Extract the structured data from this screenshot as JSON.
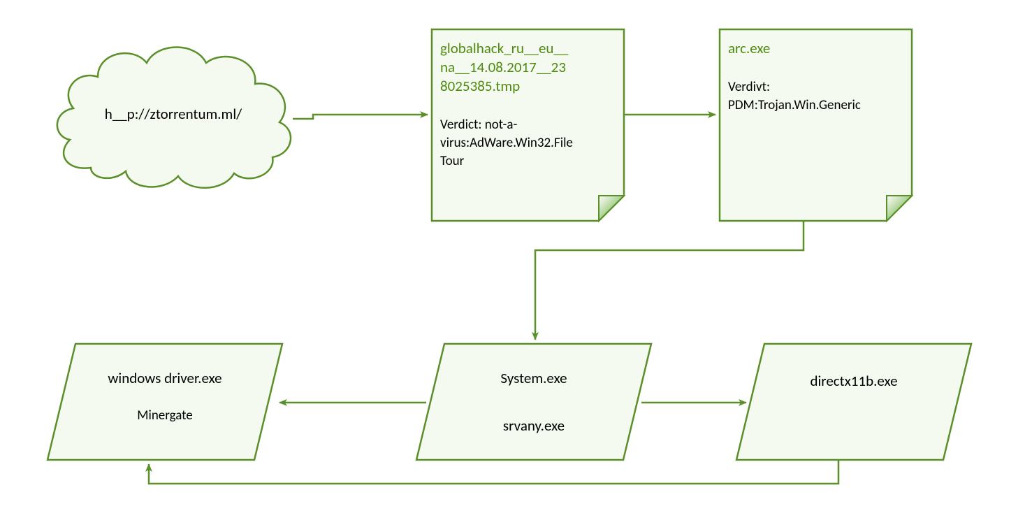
{
  "colors": {
    "stroke": "#5a8f29",
    "fill": "#f5faf0",
    "foldDark": "#3e6b1c",
    "foldLight": "#a9d18e",
    "text": "#000000",
    "greenText": "#5a8f29"
  },
  "cloud": {
    "label": "h__p://ztorrentum.ml/"
  },
  "note1": {
    "title1": "globalhack_ru__eu__",
    "title2": "na__14.08.2017__23",
    "title3": "8025385.tmp",
    "body1": "Verdict: not-a-",
    "body2": "virus:AdWare.Win32.File",
    "body3": "Tour"
  },
  "note2": {
    "title1": "arc.exe",
    "body1": "Verdivt:",
    "body2": "PDM:Trojan.Win.Generic"
  },
  "para1": {
    "line1": "windows driver.exe",
    "line2": "Minergate"
  },
  "para2": {
    "line1": "System.exe",
    "line2": "srvany.exe"
  },
  "para3": {
    "line1": "directx11b.exe"
  }
}
